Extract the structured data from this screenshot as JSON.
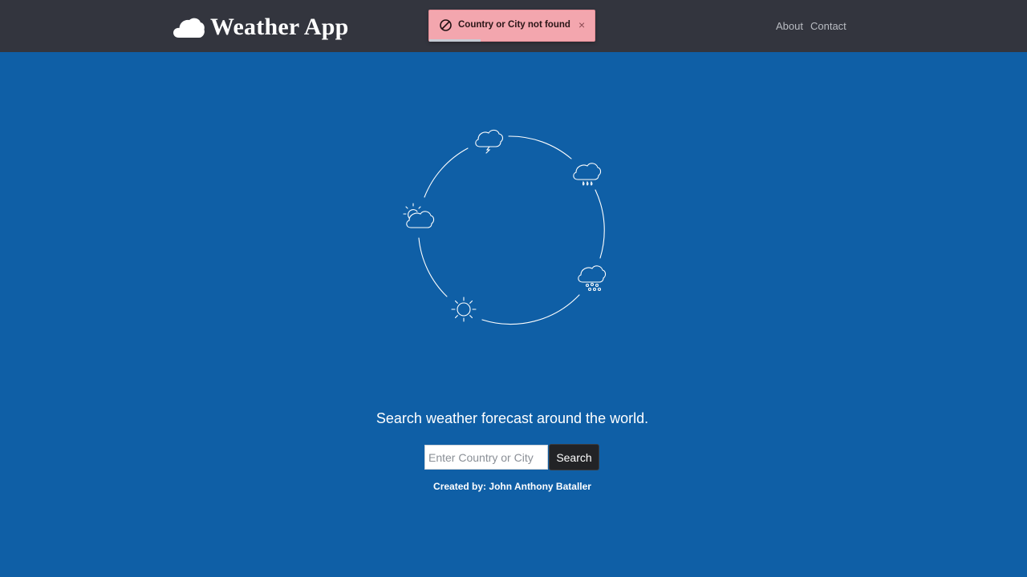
{
  "header": {
    "brand": {
      "title": "Weather App",
      "icon": "cloud-icon"
    },
    "nav": [
      {
        "label": "About"
      },
      {
        "label": "Contact"
      }
    ]
  },
  "toast": {
    "icon": "block-icon",
    "message": "Country or City not found",
    "close_label": "×",
    "progress": 0.31
  },
  "main": {
    "illustration": {
      "icons": [
        "thunderstorm-cloud-icon",
        "rain-cloud-icon",
        "snow-cloud-icon",
        "sun-icon",
        "partly-cloudy-icon"
      ]
    },
    "tagline": "Search weather forecast around the world.",
    "search": {
      "placeholder": "Enter Country or City",
      "value": "",
      "button_label": "Search"
    },
    "credits": {
      "prefix": "Created by: ",
      "author": "John Anthony Bataller"
    }
  },
  "colors": {
    "background": "#0f5fa6",
    "navbar": "#33353e",
    "toast_bg": "#f3a6ae",
    "button": "#222326"
  }
}
